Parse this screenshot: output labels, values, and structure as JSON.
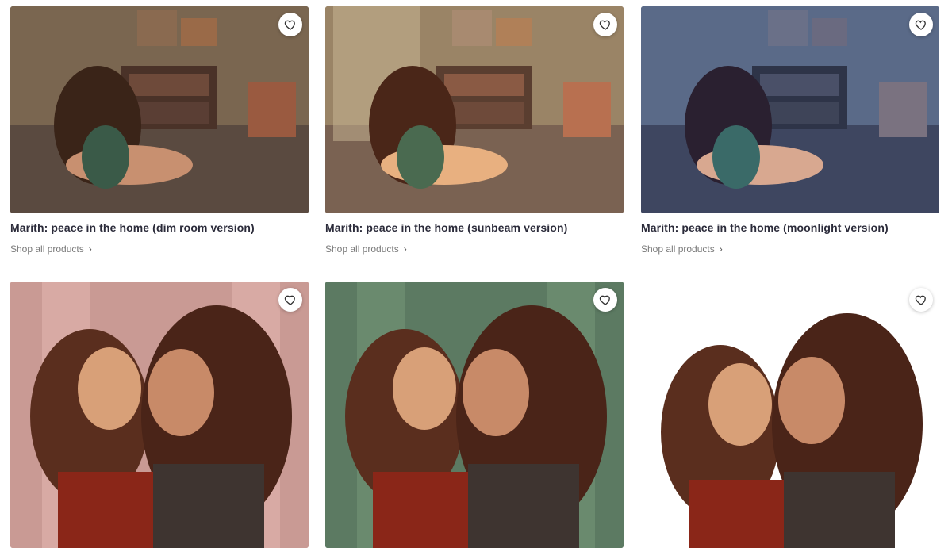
{
  "products": [
    {
      "title": "Marith: peace in the home (dim room version)",
      "shop_label": "Shop all products",
      "variant": "dim"
    },
    {
      "title": "Marith: peace in the home (sunbeam version)",
      "shop_label": "Shop all products",
      "variant": "sunbeam"
    },
    {
      "title": "Marith: peace in the home (moonlight version)",
      "shop_label": "Shop all products",
      "variant": "moonlight"
    },
    {
      "variant": "pink"
    },
    {
      "variant": "green"
    },
    {
      "variant": "white"
    }
  ],
  "icons": {
    "favorite": "heart-outline-icon",
    "shop": "chevron-right-icon"
  },
  "colors": {
    "dim": "#6b5a4a",
    "sunbeam": "#8a7458",
    "moonlight": "#4d5a78",
    "pink": "#c99a94",
    "green": "#5c7a62",
    "white": "#ffffff"
  }
}
